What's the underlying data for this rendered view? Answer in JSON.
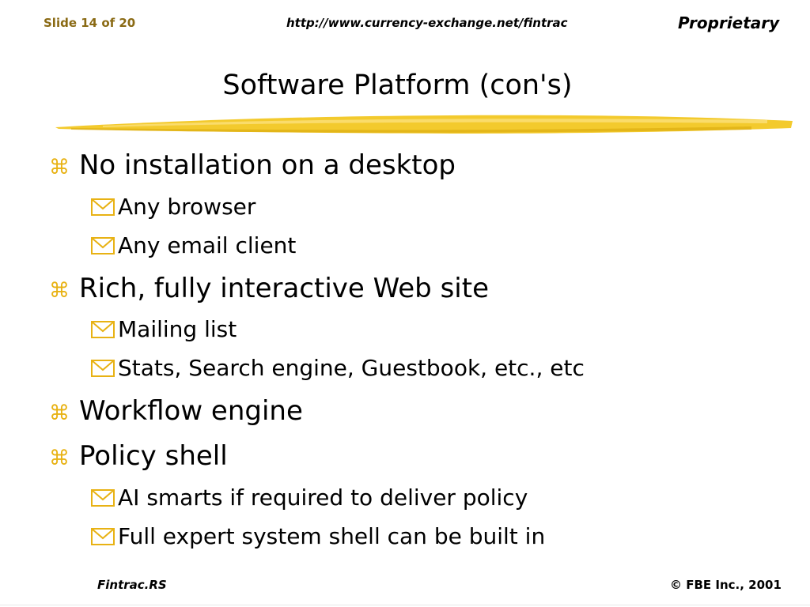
{
  "header": {
    "slide_number": "Slide 14 of 20",
    "url": "http://www.currency-exchange.net/fintrac",
    "proprietary": "Proprietary"
  },
  "title": "Software Platform (con's)",
  "bullets": [
    {
      "text": "No installation on a desktop",
      "level": 1
    },
    {
      "text": "Any browser",
      "level": 2
    },
    {
      "text": "Any email client",
      "level": 2
    },
    {
      "text": "Rich, fully interactive Web site",
      "level": 1
    },
    {
      "text": "Mailing list",
      "level": 2
    },
    {
      "text": "Stats, Search engine, Guestbook, etc., etc",
      "level": 2
    },
    {
      "text": "Workflow engine",
      "level": 1
    },
    {
      "text": "Policy shell",
      "level": 1
    },
    {
      "text": "AI smarts if required to deliver policy",
      "level": 2
    },
    {
      "text": "Full expert system shell can be built in",
      "level": 2
    }
  ],
  "footer": {
    "left": "Fintrac.RS",
    "right": "© FBE Inc., 2001"
  },
  "colors": {
    "accent": "#e8b214",
    "brush": "#f2c416",
    "slide_number": "#8a6a14"
  },
  "icons": {
    "level1_bullet": "command-key-icon",
    "level2_bullet": "envelope-check-icon"
  }
}
